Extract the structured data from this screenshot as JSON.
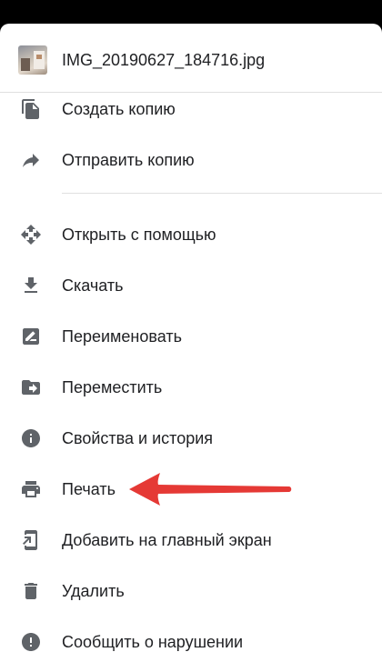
{
  "file": {
    "name": "IMG_20190627_184716.jpg",
    "thumbnail_icon": "photo-thumbnail"
  },
  "menu": {
    "items": [
      {
        "label": "Создать копию",
        "icon": "copy-icon"
      },
      {
        "label": "Отправить копию",
        "icon": "share-arrow-icon"
      },
      {
        "label": "Открыть с помощью",
        "icon": "open-with-icon"
      },
      {
        "label": "Скачать",
        "icon": "download-icon"
      },
      {
        "label": "Переименовать",
        "icon": "rename-icon"
      },
      {
        "label": "Переместить",
        "icon": "move-folder-icon"
      },
      {
        "label": "Свойства и история",
        "icon": "info-icon"
      },
      {
        "label": "Печать",
        "icon": "print-icon"
      },
      {
        "label": "Добавить на главный экран",
        "icon": "add-to-home-icon"
      },
      {
        "label": "Удалить",
        "icon": "trash-icon"
      },
      {
        "label": "Сообщить о нарушении",
        "icon": "report-icon"
      }
    ]
  },
  "colors": {
    "icon": "#5f6368",
    "text": "#202124",
    "annotation_arrow": "#e53935"
  }
}
